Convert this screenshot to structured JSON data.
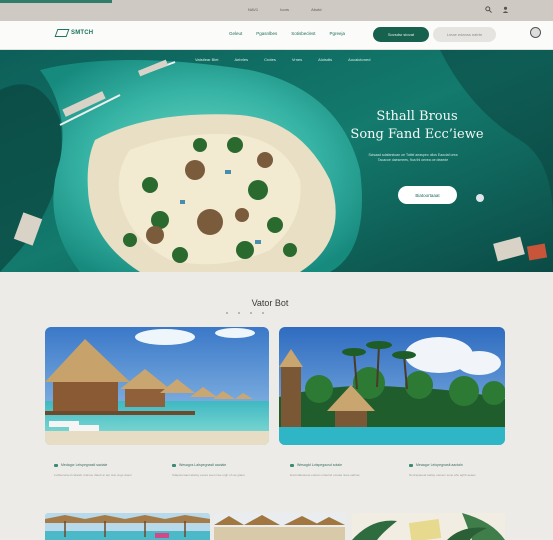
{
  "topbar": {
    "links": [
      "NAV1",
      "Ioors",
      "Abotd"
    ],
    "icons": [
      "search-icon",
      "user-icon"
    ]
  },
  "nav": {
    "logo": "SMTCH",
    "items": [
      "Geleut",
      "Pgasnlbes",
      "Sotisbeclest",
      "Pgreeja"
    ],
    "primary_button": "Sovsdsr stovat",
    "secondary_button": "Lmae edanss eatrte"
  },
  "hero": {
    "subnav": [
      "Vatstlear Blet",
      "Aebrles",
      "Crotes",
      "Vrnes",
      "Aloisdts",
      "Aocalotoned"
    ],
    "title_line1": "Sthall Brous",
    "title_line2": "Song Fand Ecc’iewe",
    "subtitle_line1": "Scisaad sdafarstoan oe Tottel aeaspeo ollos Eaoclaf orea",
    "subtitle_line2": "Tacacoe daesmees, fioa thl oevea oe deaede",
    "cta": "Biatoortaaat"
  },
  "section": {
    "title": "Vator Bot"
  },
  "cards": [
    {
      "caption": "Medagcr Lelspegnastl sactale",
      "sub": "Ludbenarsed catateb ortanoe dtaeb ar arp stat onge doaur"
    },
    {
      "caption": "Wesagcs Lalspegnastl aactale",
      "sub": "Sdapancoaet akelay eeses seet nrae orgh oh ae gtiaer"
    },
    {
      "caption": "Wesagtd Lotspegaosd sotale",
      "sub": "Euotnddeaneet etanan ortaetnd ocetaa nteie earhae"
    },
    {
      "caption": "Meaagcr Lelopegnaslt aactaln",
      "sub": "Nonrapaeeat aeltay oasnen sene ahe aghb aeaes"
    }
  ],
  "colors": {
    "brand": "#17614f",
    "accent": "#2f7e6b",
    "background": "#ecebe7"
  }
}
